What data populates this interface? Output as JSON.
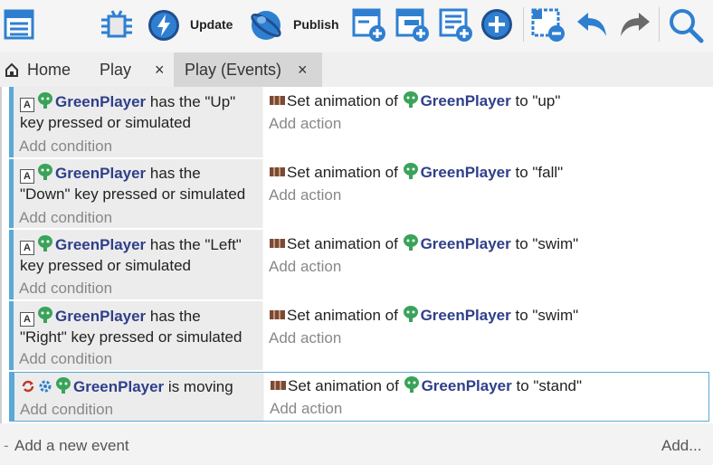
{
  "toolbar": {
    "update_label": "Update",
    "publish_label": "Publish"
  },
  "tabs": [
    {
      "label": "Home"
    },
    {
      "label": "Play",
      "close": "×"
    },
    {
      "label": "Play (Events)",
      "close": "×"
    }
  ],
  "events": [
    {
      "condition_object": "GreenPlayer",
      "condition_line1": " has the \"Up\"",
      "condition_line2": "key pressed or simulated",
      "add_condition": "Add condition",
      "action_prefix": "Set animation of ",
      "action_object": "GreenPlayer",
      "action_suffix": " to \"up\"",
      "add_action": "Add action"
    },
    {
      "condition_object": "GreenPlayer",
      "condition_line1": " has the",
      "condition_line2": "\"Down\" key pressed or simulated",
      "add_condition": "Add condition",
      "action_prefix": "Set animation of ",
      "action_object": "GreenPlayer",
      "action_suffix": " to \"fall\"",
      "add_action": "Add action"
    },
    {
      "condition_object": "GreenPlayer",
      "condition_line1": " has the \"Left\"",
      "condition_line2": "key pressed or simulated",
      "add_condition": "Add condition",
      "action_prefix": "Set animation of ",
      "action_object": "GreenPlayer",
      "action_suffix": " to \"swim\"",
      "add_action": "Add action"
    },
    {
      "condition_object": "GreenPlayer",
      "condition_line1": " has the",
      "condition_line2": "\"Right\" key pressed or simulated",
      "add_condition": "Add condition",
      "action_prefix": "Set animation of ",
      "action_object": "GreenPlayer",
      "action_suffix": " to \"swim\"",
      "add_action": "Add action"
    },
    {
      "condition_object": "GreenPlayer",
      "condition_line1": " is moving",
      "add_condition": "Add condition",
      "action_prefix": "Set animation of ",
      "action_object": "GreenPlayer",
      "action_suffix": " to \"stand\"",
      "add_action": "Add action"
    }
  ],
  "footer": {
    "add_event": "Add a new event",
    "add_more": "Add..."
  },
  "colors": {
    "object_name": "#2e3f8a",
    "event_bar": "#5aa9d6",
    "toolbar_icon": "#2f7fd1"
  }
}
